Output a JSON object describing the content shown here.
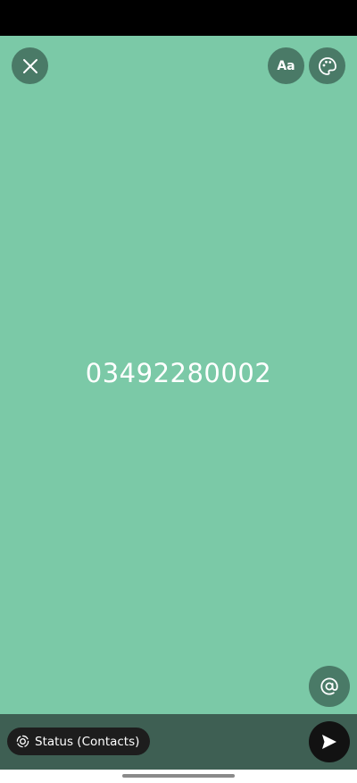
{
  "composer": {
    "status_text": "03492280002",
    "background_color": "#7bc9a7",
    "font_button_label": "Aa"
  },
  "toolbar": {
    "close_icon": "close-icon",
    "palette_icon": "palette-icon",
    "mention_icon": "at-sign-icon"
  },
  "footer": {
    "privacy_label": "Status (Contacts)",
    "privacy_icon": "status-ring-icon",
    "send_icon": "send-icon"
  }
}
